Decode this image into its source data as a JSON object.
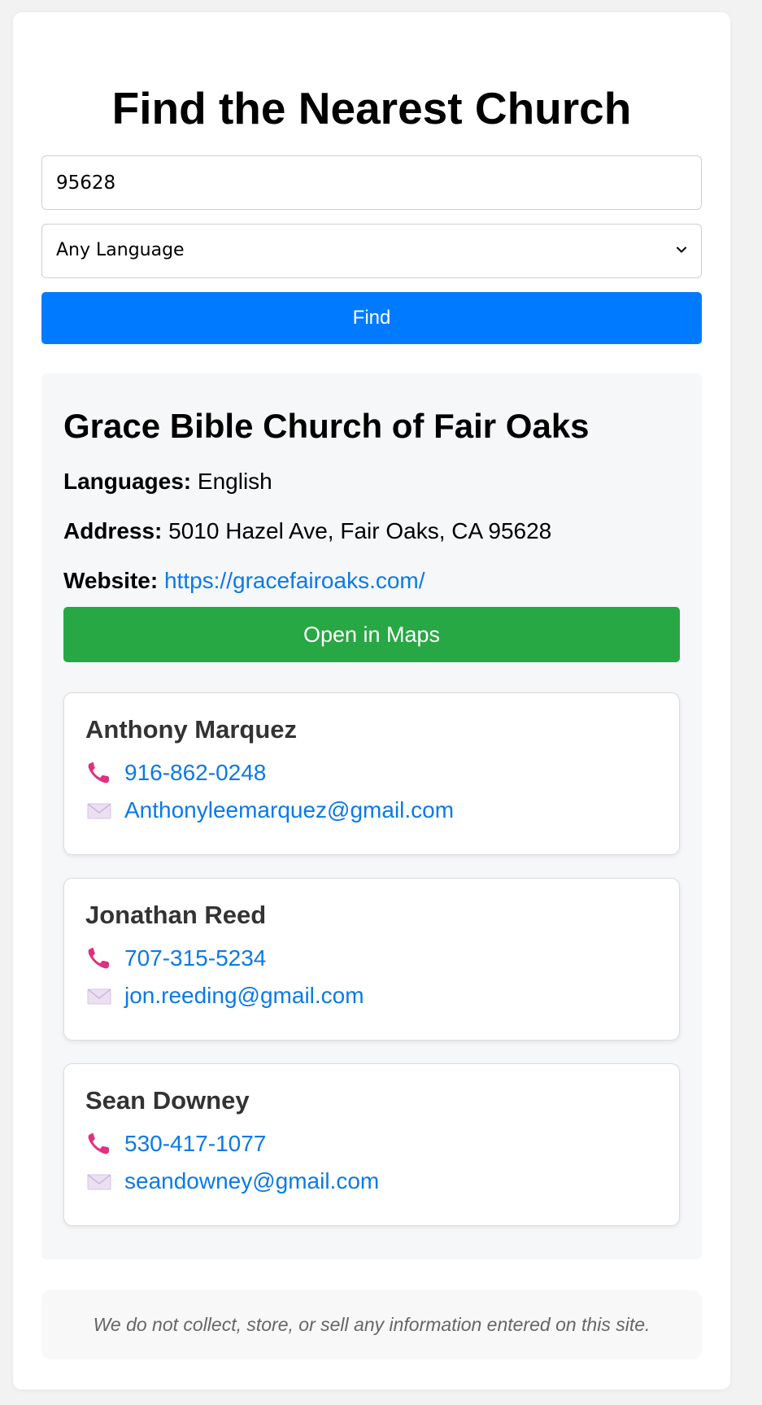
{
  "page": {
    "title": "Find the Nearest Church"
  },
  "search": {
    "zip_value": "95628",
    "language_selected": "Any Language",
    "find_label": "Find"
  },
  "result": {
    "church_name": "Grace Bible Church of Fair Oaks",
    "languages_label": "Languages:",
    "languages_value": "English",
    "address_label": "Address:",
    "address_value": "5010 Hazel Ave, Fair Oaks, CA 95628",
    "website_label": "Website:",
    "website_value": "https://gracefairoaks.com/",
    "maps_label": "Open in Maps",
    "contacts": [
      {
        "name": "Anthony Marquez",
        "phone": "916-862-0248",
        "email": "Anthonyleemarquez@gmail.com"
      },
      {
        "name": "Jonathan Reed",
        "phone": "707-315-5234",
        "email": "jon.reeding@gmail.com"
      },
      {
        "name": "Sean Downey",
        "phone": "530-417-1077",
        "email": "seandowney@gmail.com"
      }
    ]
  },
  "footer": {
    "privacy_note": "We do not collect, store, or sell any information entered on this site."
  },
  "icons": {
    "phone": "telephone-receiver-icon",
    "email": "envelope-icon",
    "select": "chevron-down-icon"
  },
  "colors": {
    "primary": "#007bff",
    "maps_button": "#28a745",
    "link": "#0a7ae6",
    "phone_icon": "#e0307e"
  }
}
